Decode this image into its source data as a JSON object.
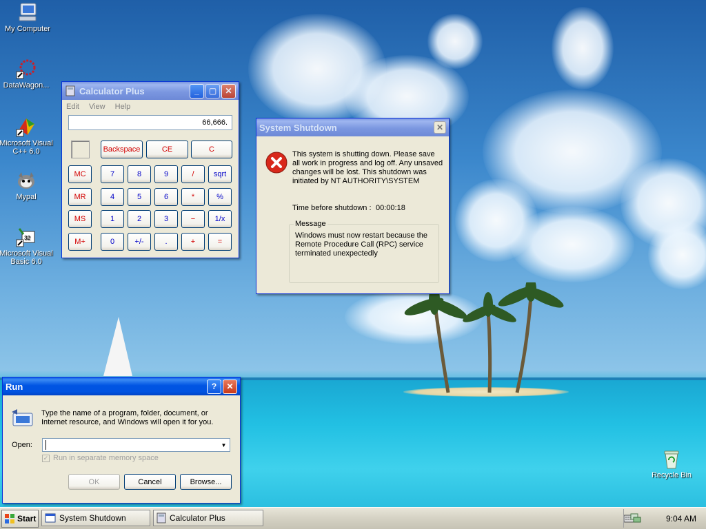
{
  "desktop": {
    "icons": [
      {
        "label": "My Computer"
      },
      {
        "label": "DataWagon..."
      },
      {
        "label": "Microsoft Visual C++ 6.0"
      },
      {
        "label": "Mypal"
      },
      {
        "label": "Microsoft Visual Basic 6.0"
      },
      {
        "label": "Recycle Bin"
      }
    ]
  },
  "calculator": {
    "title": "Calculator Plus",
    "menu": [
      "Edit",
      "View",
      "Help"
    ],
    "display": "66,666.",
    "top_buttons": [
      "Backspace",
      "CE",
      "C"
    ],
    "memory_buttons": [
      "MC",
      "MR",
      "MS",
      "M+"
    ],
    "keys": [
      [
        "7",
        "8",
        "9",
        "/",
        "sqrt"
      ],
      [
        "4",
        "5",
        "6",
        "*",
        "%"
      ],
      [
        "1",
        "2",
        "3",
        "−",
        "1/x"
      ],
      [
        "0",
        "+/-",
        ".",
        "+",
        "="
      ]
    ]
  },
  "shutdown": {
    "title": "System Shutdown",
    "message": "This system is shutting down. Please save all work in progress and log off. Any unsaved changes will be lost. This shutdown was initiated by NT AUTHORITY\\SYSTEM",
    "time_label": "Time before shutdown :",
    "time_value": "00:00:18",
    "group_label": "Message",
    "group_text": "Windows must now restart because the Remote Procedure Call (RPC) service terminated unexpectedly"
  },
  "run": {
    "title": "Run",
    "description": "Type the name of a program, folder, document, or Internet resource, and Windows will open it for you.",
    "open_label": "Open:",
    "open_value": "",
    "checkbox_label": "Run in separate memory space",
    "ok_label": "OK",
    "cancel_label": "Cancel",
    "browse_label": "Browse..."
  },
  "taskbar": {
    "start_label": "Start",
    "items": [
      "System Shutdown",
      "Calculator Plus"
    ],
    "clock": "9:04 AM"
  }
}
